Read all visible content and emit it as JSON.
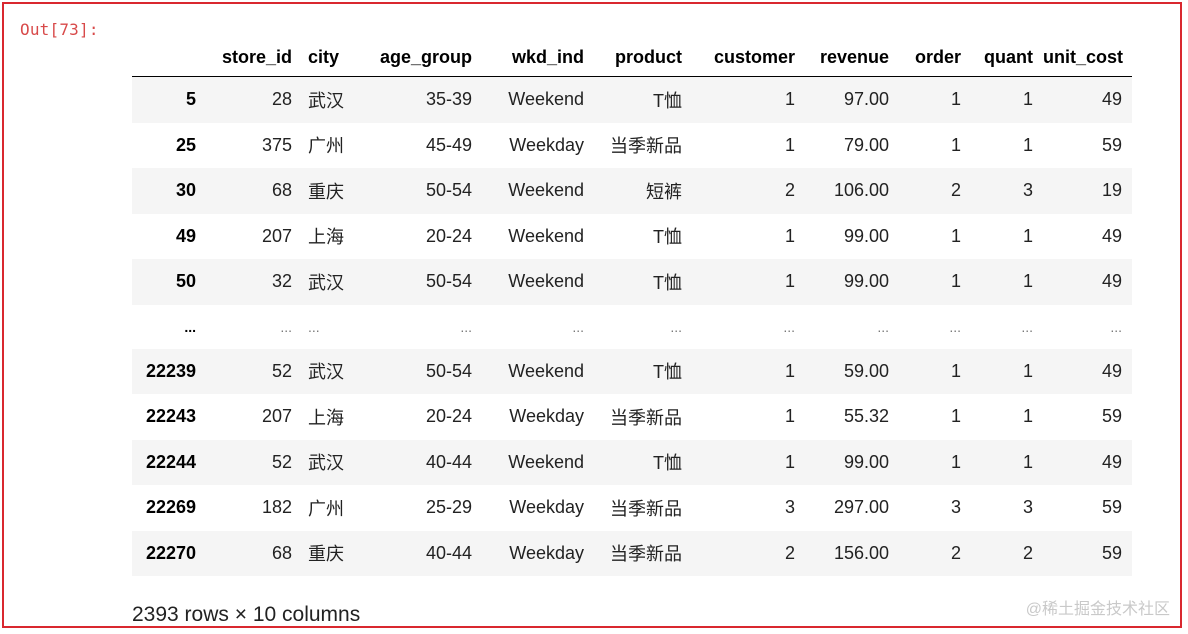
{
  "prompt": "Out[73]:",
  "table": {
    "columns": [
      "",
      "store_id",
      "city",
      "age_group",
      "wkd_ind",
      "product",
      "customer",
      "revenue",
      "order",
      "quant",
      "unit_cost"
    ],
    "rows": [
      [
        "5",
        "28",
        "武汉",
        "35-39",
        "Weekend",
        "T恤",
        "1",
        "97.00",
        "1",
        "1",
        "49"
      ],
      [
        "25",
        "375",
        "广州",
        "45-49",
        "Weekday",
        "当季新品",
        "1",
        "79.00",
        "1",
        "1",
        "59"
      ],
      [
        "30",
        "68",
        "重庆",
        "50-54",
        "Weekend",
        "短裤",
        "2",
        "106.00",
        "2",
        "3",
        "19"
      ],
      [
        "49",
        "207",
        "上海",
        "20-24",
        "Weekend",
        "T恤",
        "1",
        "99.00",
        "1",
        "1",
        "49"
      ],
      [
        "50",
        "32",
        "武汉",
        "50-54",
        "Weekend",
        "T恤",
        "1",
        "99.00",
        "1",
        "1",
        "49"
      ],
      [
        "...",
        "...",
        "...",
        "...",
        "...",
        "...",
        "...",
        "...",
        "...",
        "...",
        "..."
      ],
      [
        "22239",
        "52",
        "武汉",
        "50-54",
        "Weekend",
        "T恤",
        "1",
        "59.00",
        "1",
        "1",
        "49"
      ],
      [
        "22243",
        "207",
        "上海",
        "20-24",
        "Weekday",
        "当季新品",
        "1",
        "55.32",
        "1",
        "1",
        "59"
      ],
      [
        "22244",
        "52",
        "武汉",
        "40-44",
        "Weekend",
        "T恤",
        "1",
        "99.00",
        "1",
        "1",
        "49"
      ],
      [
        "22269",
        "182",
        "广州",
        "25-29",
        "Weekday",
        "当季新品",
        "3",
        "297.00",
        "3",
        "3",
        "59"
      ],
      [
        "22270",
        "68",
        "重庆",
        "40-44",
        "Weekday",
        "当季新品",
        "2",
        "156.00",
        "2",
        "2",
        "59"
      ]
    ]
  },
  "summary": "2393 rows × 10 columns",
  "watermark": "@稀土掘金技术社区",
  "colors": {
    "frame_border": "#d9282f",
    "prompt_text": "#d84a4a",
    "row_stripe": "#f5f5f5"
  }
}
